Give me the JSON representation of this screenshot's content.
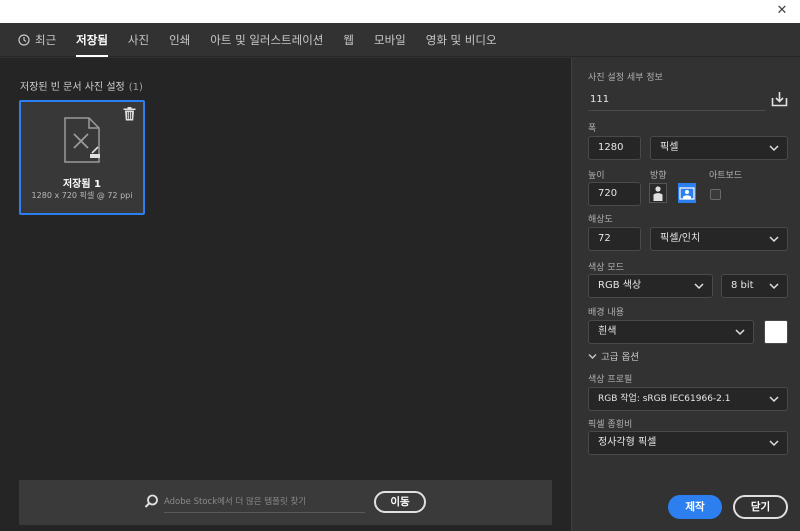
{
  "titlebar": {
    "close_glyph": "✕"
  },
  "tabs": [
    {
      "label": "최근"
    },
    {
      "label": "저장됨"
    },
    {
      "label": "사진"
    },
    {
      "label": "인쇄"
    },
    {
      "label": "아트 및 일러스트레이션"
    },
    {
      "label": "웹"
    },
    {
      "label": "모바일"
    },
    {
      "label": "영화 및 비디오"
    }
  ],
  "saved": {
    "section_title": "저장된 빈 문서 사진 설정",
    "count": "(1)",
    "preset_name": "저장됨 1",
    "preset_meta": "1280 x 720 픽셀 @ 72 ppi"
  },
  "stock": {
    "placeholder": "Adobe Stock에서 더 많은 템플릿 찾기",
    "go_label": "이동"
  },
  "details": {
    "header": "사진 설정 세부 정보",
    "preset_name_value": "111",
    "width_label": "폭",
    "width_value": "1280",
    "width_unit": "픽셀",
    "height_label": "높이",
    "height_value": "720",
    "orientation_label": "방향",
    "artboard_label": "아트보드",
    "resolution_label": "해상도",
    "resolution_value": "72",
    "resolution_unit": "픽셀/인치",
    "color_mode_label": "색상 모드",
    "color_mode_value": "RGB 색상",
    "bit_depth_value": "8 bit",
    "background_label": "배경 내용",
    "background_value": "흰색",
    "advanced_label": "고급 옵션",
    "color_profile_label": "색상 프로필",
    "color_profile_value": "RGB 작업: sRGB IEC61966-2.1",
    "pixel_ratio_label": "픽셀 종횡비",
    "pixel_ratio_value": "정사각형 픽셀"
  },
  "buttons": {
    "create_label": "제작",
    "close_label": "닫기"
  },
  "colors": {
    "accent": "#2d7ff0",
    "background_swatch": "#ffffff"
  }
}
